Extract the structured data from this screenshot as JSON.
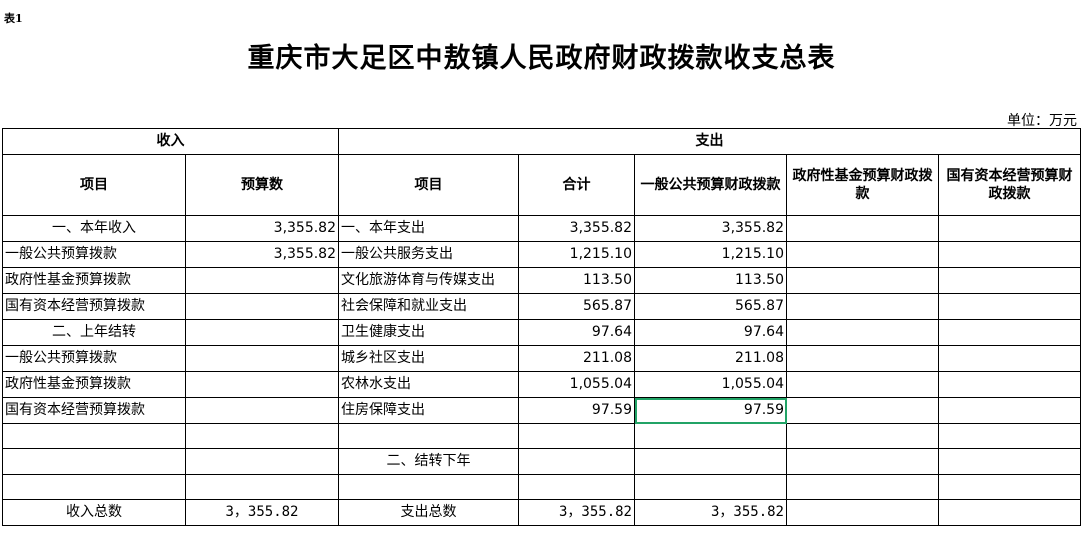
{
  "table_label": "表1",
  "title": "重庆市大足区中敖镇人民政府财政拨款收支总表",
  "unit": "单位：万元",
  "header": {
    "income": "收入",
    "expense": "支出",
    "col_item": "项目",
    "col_budget": "预算数",
    "col_item2": "项目",
    "col_total": "合计",
    "col_general": "一般公共预算财政拨款",
    "col_fund": "政府性基金预算财政拨款",
    "col_state": "国有资本经营预算财政拨款"
  },
  "rows": [
    {
      "in_item": "一、本年收入",
      "in_amt": "3,355.82",
      "out_item": "一、本年支出",
      "total": "3,355.82",
      "general": "3,355.82",
      "fund": "",
      "state": ""
    },
    {
      "in_item": "一般公共预算拨款",
      "in_amt": "3,355.82",
      "out_item": "一般公共服务支出",
      "total": "1,215.10",
      "general": "1,215.10",
      "fund": "",
      "state": ""
    },
    {
      "in_item": "政府性基金预算拨款",
      "in_amt": "",
      "out_item": "文化旅游体育与传媒支出",
      "total": "113.50",
      "general": "113.50",
      "fund": "",
      "state": ""
    },
    {
      "in_item": "国有资本经营预算拨款",
      "in_amt": "",
      "out_item": "社会保障和就业支出",
      "total": "565.87",
      "general": "565.87",
      "fund": "",
      "state": ""
    },
    {
      "in_item": "二、上年结转",
      "in_amt": "",
      "out_item": "卫生健康支出",
      "total": "97.64",
      "general": "97.64",
      "fund": "",
      "state": ""
    },
    {
      "in_item": "一般公共预算拨款",
      "in_amt": "",
      "out_item": "城乡社区支出",
      "total": "211.08",
      "general": "211.08",
      "fund": "",
      "state": ""
    },
    {
      "in_item": "政府性基金预算拨款",
      "in_amt": "",
      "out_item": "农林水支出",
      "total": "1,055.04",
      "general": "1,055.04",
      "fund": "",
      "state": ""
    },
    {
      "in_item": "国有资本经营预算拨款",
      "in_amt": "",
      "out_item": "住房保障支出",
      "total": "97.59",
      "general": "97.59",
      "fund": "",
      "state": ""
    },
    {
      "in_item": "",
      "in_amt": "",
      "out_item": "",
      "total": "",
      "general": "",
      "fund": "",
      "state": ""
    },
    {
      "in_item": "",
      "in_amt": "",
      "out_item": "二、结转下年",
      "total": "",
      "general": "",
      "fund": "",
      "state": ""
    },
    {
      "in_item": "",
      "in_amt": "",
      "out_item": "",
      "total": "",
      "general": "",
      "fund": "",
      "state": ""
    }
  ],
  "totals": {
    "in_label": "收入总数",
    "in_amt": "3，355.82",
    "out_label": "支出总数",
    "total": "3，355.82",
    "general": "3，355.82"
  },
  "colors": {
    "selection": "#21a366"
  }
}
